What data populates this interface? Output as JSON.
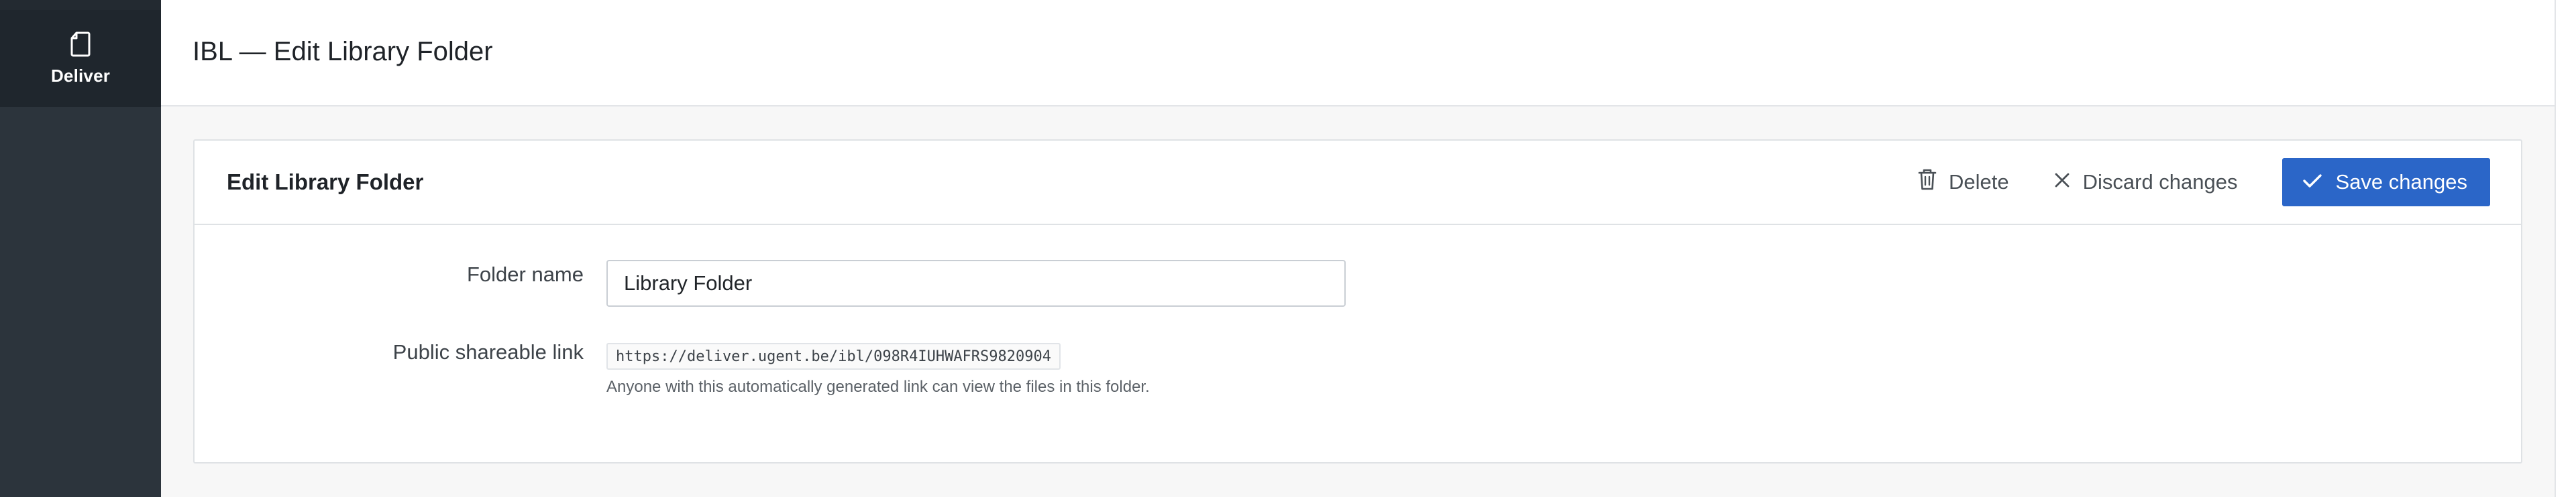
{
  "sidebar": {
    "brand_label": "Deliver",
    "brand_icon": "document-icon"
  },
  "header": {
    "title": "IBL — Edit Library Folder"
  },
  "card": {
    "title": "Edit Library Folder",
    "actions": {
      "delete_label": "Delete",
      "discard_label": "Discard changes",
      "save_label": "Save changes"
    }
  },
  "form": {
    "folder_name_label": "Folder name",
    "folder_name_value": "Library Folder",
    "share_link_label": "Public shareable link",
    "share_link_value": "https://deliver.ugent.be/ibl/098R4IUHWAFRS9820904",
    "share_link_help": "Anyone with this automatically generated link can view the files in this folder."
  },
  "colors": {
    "primary": "#2b66c8",
    "sidebar_bg": "#2c343c",
    "sidebar_brand_bg": "#1f262d"
  }
}
